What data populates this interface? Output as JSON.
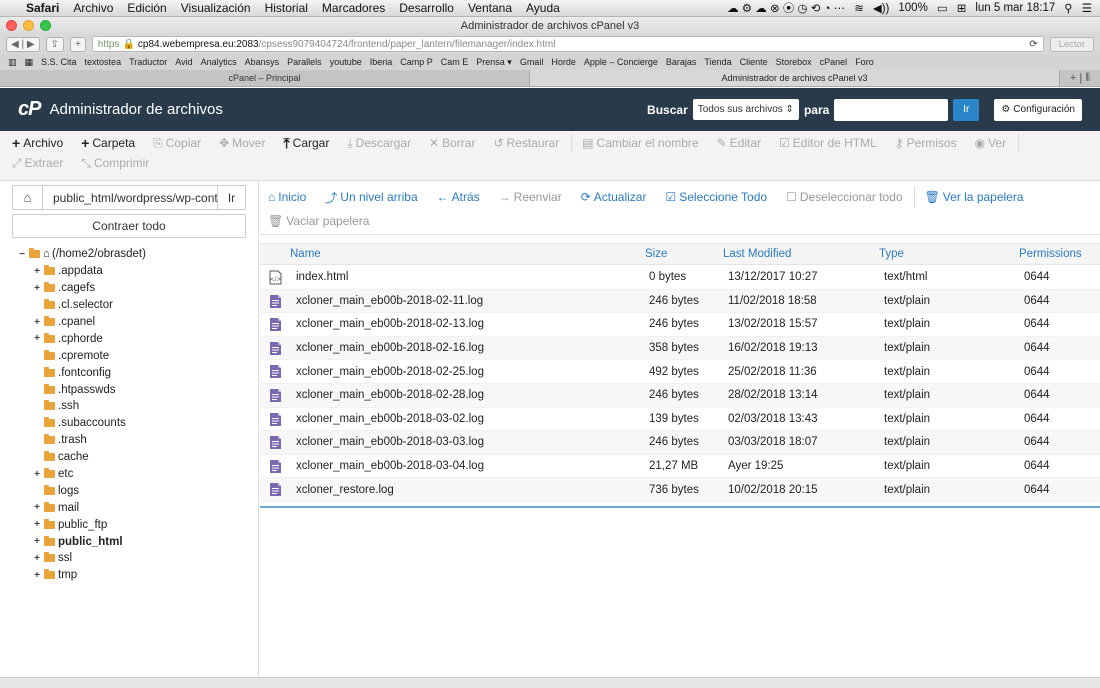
{
  "mac_menu": {
    "app": "Safari",
    "items": [
      "Archivo",
      "Edición",
      "Visualización",
      "Historial",
      "Marcadores",
      "Desarrollo",
      "Ventana",
      "Ayuda"
    ],
    "battery": "100%",
    "clock": "lun 5 mar  18:17"
  },
  "window_title": "Administrador de archivos cPanel v3",
  "url": {
    "scheme": "https",
    "domain": "cp84.webempresa.eu:2083",
    "path": "/cpsess9079404724/frontend/paper_lantern/filemanager/index.html",
    "reader": "Lector"
  },
  "bookmarks": [
    "S.S. Cita",
    "textostea",
    "Traductor",
    "Avid",
    "Analytics",
    "Abansys",
    "Parallels",
    "youtube",
    "Iberia",
    "Camp P",
    "Cam E",
    "Prensa ▾",
    "Gmail",
    "Horde",
    "Apple – Concierge",
    "Barajas",
    "Tienda",
    "Cliente",
    "Storebox",
    "cPanel",
    "Foro"
  ],
  "tabs": [
    "cPanel – Principal",
    "Administrador de archivos cPanel v3"
  ],
  "header": {
    "logo": "cP",
    "title": "Administrador de archivos",
    "search_label": "Buscar",
    "search_scope": "Todos sus archivos",
    "for_label": "para",
    "go_label": "Ir",
    "config_label": "Configuración"
  },
  "toolbar": [
    {
      "label": "Archivo",
      "icon": "plus-icon",
      "enabled": true
    },
    {
      "label": "Carpeta",
      "icon": "plus-icon",
      "enabled": true
    },
    {
      "label": "Copiar",
      "icon": "copy-icon",
      "enabled": false
    },
    {
      "label": "Mover",
      "icon": "move-icon",
      "enabled": false
    },
    {
      "label": "Cargar",
      "icon": "upload-icon",
      "enabled": true
    },
    {
      "label": "Descargar",
      "icon": "download-icon",
      "enabled": false
    },
    {
      "label": "Borrar",
      "icon": "delete-icon",
      "enabled": false
    },
    {
      "label": "Restaurar",
      "icon": "restore-icon",
      "enabled": false
    },
    {
      "label": "Cambiar el nombre",
      "icon": "rename-icon",
      "enabled": false
    },
    {
      "label": "Editar",
      "icon": "edit-icon",
      "enabled": false
    },
    {
      "label": "Editor de HTML",
      "icon": "html-editor-icon",
      "enabled": false
    },
    {
      "label": "Permisos",
      "icon": "key-icon",
      "enabled": false
    },
    {
      "label": "Ver",
      "icon": "eye-icon",
      "enabled": false
    },
    {
      "label": "Extraer",
      "icon": "extract-icon",
      "enabled": false
    },
    {
      "label": "Comprimir",
      "icon": "compress-icon",
      "enabled": false
    }
  ],
  "sidebar": {
    "path_value": "public_html/wordpress/wp-cont",
    "go_label": "Ir",
    "collapse_label": "Contraer todo",
    "root": "(/home2/obrasdet)",
    "tree": [
      {
        "label": ".appdata",
        "expand": true
      },
      {
        "label": ".cagefs",
        "expand": true
      },
      {
        "label": ".cl.selector",
        "expand": false
      },
      {
        "label": ".cpanel",
        "expand": true
      },
      {
        "label": ".cphorde",
        "expand": true
      },
      {
        "label": ".cpremote",
        "expand": false
      },
      {
        "label": ".fontconfig",
        "expand": false
      },
      {
        "label": ".htpasswds",
        "expand": false
      },
      {
        "label": ".ssh",
        "expand": false
      },
      {
        "label": ".subaccounts",
        "expand": false
      },
      {
        "label": ".trash",
        "expand": false
      },
      {
        "label": "cache",
        "expand": false
      },
      {
        "label": "etc",
        "expand": true
      },
      {
        "label": "logs",
        "expand": false
      },
      {
        "label": "mail",
        "expand": true
      },
      {
        "label": "public_ftp",
        "expand": true
      },
      {
        "label": "public_html",
        "expand": true,
        "bold": true
      },
      {
        "label": "ssl",
        "expand": true
      },
      {
        "label": "tmp",
        "expand": true
      }
    ]
  },
  "nav": [
    {
      "label": "Inicio",
      "icon": "home-icon",
      "enabled": true
    },
    {
      "label": "Un nivel arriba",
      "icon": "level-up-icon",
      "enabled": true
    },
    {
      "label": "Atrás",
      "icon": "arrow-left-icon",
      "enabled": true
    },
    {
      "label": "Reenviar",
      "icon": "arrow-right-icon",
      "enabled": false
    },
    {
      "label": "Actualizar",
      "icon": "refresh-icon",
      "enabled": true
    },
    {
      "label": "Seleccione Todo",
      "icon": "checkbox-checked-icon",
      "enabled": true
    },
    {
      "label": "Deseleccionar todo",
      "icon": "checkbox-empty-icon",
      "enabled": false
    },
    {
      "label": "Ver la papelera",
      "icon": "trash-icon",
      "enabled": true
    },
    {
      "label": "Vaciar papelera",
      "icon": "trash-icon",
      "enabled": false
    }
  ],
  "table": {
    "headers": {
      "name": "Name",
      "size": "Size",
      "modified": "Last Modified",
      "type": "Type",
      "perms": "Permissions"
    },
    "rows": [
      {
        "name": "index.html",
        "size": "0 bytes",
        "modified": "13/12/2017 10:27",
        "type": "text/html",
        "perms": "0644",
        "icon": "html-file-icon"
      },
      {
        "name": "xcloner_main_eb00b-2018-02-11.log",
        "size": "246 bytes",
        "modified": "11/02/2018 18:58",
        "type": "text/plain",
        "perms": "0644",
        "icon": "text-file-icon"
      },
      {
        "name": "xcloner_main_eb00b-2018-02-13.log",
        "size": "246 bytes",
        "modified": "13/02/2018 15:57",
        "type": "text/plain",
        "perms": "0644",
        "icon": "text-file-icon"
      },
      {
        "name": "xcloner_main_eb00b-2018-02-16.log",
        "size": "358 bytes",
        "modified": "16/02/2018 19:13",
        "type": "text/plain",
        "perms": "0644",
        "icon": "text-file-icon"
      },
      {
        "name": "xcloner_main_eb00b-2018-02-25.log",
        "size": "492 bytes",
        "modified": "25/02/2018 11:36",
        "type": "text/plain",
        "perms": "0644",
        "icon": "text-file-icon"
      },
      {
        "name": "xcloner_main_eb00b-2018-02-28.log",
        "size": "246 bytes",
        "modified": "28/02/2018 13:14",
        "type": "text/plain",
        "perms": "0644",
        "icon": "text-file-icon"
      },
      {
        "name": "xcloner_main_eb00b-2018-03-02.log",
        "size": "139 bytes",
        "modified": "02/03/2018 13:43",
        "type": "text/plain",
        "perms": "0644",
        "icon": "text-file-icon"
      },
      {
        "name": "xcloner_main_eb00b-2018-03-03.log",
        "size": "246 bytes",
        "modified": "03/03/2018 18:07",
        "type": "text/plain",
        "perms": "0644",
        "icon": "text-file-icon"
      },
      {
        "name": "xcloner_main_eb00b-2018-03-04.log",
        "size": "21,27 MB",
        "modified": "Ayer 19:25",
        "type": "text/plain",
        "perms": "0644",
        "icon": "text-file-icon"
      },
      {
        "name": "xcloner_restore.log",
        "size": "736 bytes",
        "modified": "10/02/2018 20:15",
        "type": "text/plain",
        "perms": "0644",
        "icon": "text-file-icon"
      }
    ]
  },
  "colors": {
    "header_bg": "#293a4a",
    "link": "#2a7ac4",
    "folder": "#e8a33a",
    "file_icon": "#7b68b0"
  }
}
